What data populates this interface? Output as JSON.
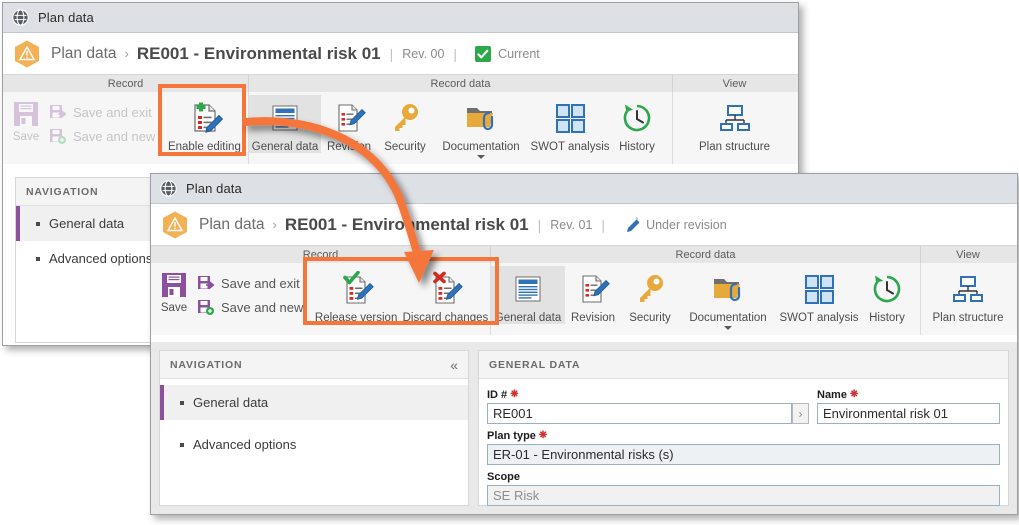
{
  "accent": {
    "highlight_orange": "#f4763b",
    "purple": "#8e4f9e",
    "blue": "#2f72b8",
    "green": "#2aa84a",
    "amber": "#f0ad49",
    "red": "#d42c22"
  },
  "window_back": {
    "titlebar": {
      "icon": "globe-icon",
      "title": "Plan data"
    },
    "header": {
      "app_icon": "warning-hexagon-icon",
      "breadcrumb_app": "Plan data",
      "breadcrumb_separator": "›",
      "record_title": "RE001 - Environmental risk 01",
      "pipe": "|",
      "revision": "Rev. 00",
      "status_icon": "green-check-icon",
      "status": "Current"
    },
    "ribbon": {
      "groups": [
        {
          "label": "Record"
        },
        {
          "label": "Record data"
        },
        {
          "label": "View"
        }
      ],
      "record": {
        "save_label": "Save",
        "save_and_exit_label": "Save and exit",
        "save_and_new_label": "Save and new",
        "enable_editing_label": "Enable editing"
      },
      "record_data": [
        {
          "label": "General data",
          "icon": "document-lines-icon",
          "selected": true
        },
        {
          "label": "Revision",
          "icon": "document-pencil-icon",
          "selected": false
        },
        {
          "label": "Security",
          "icon": "key-icon",
          "selected": false
        },
        {
          "label": "Documentation",
          "icon": "folder-clip-icon",
          "selected": false,
          "has_menu": true
        },
        {
          "label": "SWOT analysis",
          "icon": "four-squares-icon",
          "selected": false
        },
        {
          "label": "History",
          "icon": "clock-revert-icon",
          "selected": false
        }
      ],
      "view": [
        {
          "label": "Plan structure",
          "icon": "org-chart-icon"
        }
      ]
    },
    "navigation": {
      "title": "NAVIGATION",
      "items": [
        {
          "label": "General data",
          "active": true
        },
        {
          "label": "Advanced options",
          "active": false
        }
      ]
    }
  },
  "window_front": {
    "titlebar": {
      "icon": "globe-icon",
      "title": "Plan data"
    },
    "header": {
      "app_icon": "warning-hexagon-icon",
      "breadcrumb_app": "Plan data",
      "breadcrumb_separator": "›",
      "record_title": "RE001 - Environmental risk 01",
      "pipe": "|",
      "revision": "Rev. 01",
      "status_icon": "blue-pencil-icon",
      "status": "Under revision"
    },
    "ribbon": {
      "groups": [
        {
          "label": "Record"
        },
        {
          "label": "Record data"
        },
        {
          "label": "View"
        }
      ],
      "record": {
        "save_label": "Save",
        "save_and_exit_label": "Save and exit",
        "save_and_new_label": "Save and new",
        "release_version_label": "Release version",
        "discard_changes_label": "Discard changes"
      },
      "record_data": [
        {
          "label": "General data",
          "icon": "document-lines-icon",
          "selected": true
        },
        {
          "label": "Revision",
          "icon": "document-pencil-icon",
          "selected": false
        },
        {
          "label": "Security",
          "icon": "key-icon",
          "selected": false
        },
        {
          "label": "Documentation",
          "icon": "folder-clip-icon",
          "selected": false,
          "has_menu": true
        },
        {
          "label": "SWOT analysis",
          "icon": "four-squares-icon",
          "selected": false
        },
        {
          "label": "History",
          "icon": "clock-revert-icon",
          "selected": false
        }
      ],
      "view": [
        {
          "label": "Plan structure",
          "icon": "org-chart-icon"
        }
      ]
    },
    "navigation": {
      "title": "NAVIGATION",
      "collapse_icon": "«",
      "items": [
        {
          "label": "General data",
          "active": true
        },
        {
          "label": "Advanced options",
          "active": false
        }
      ]
    },
    "general_data": {
      "title": "GENERAL DATA",
      "fields": {
        "id_label": "ID #",
        "id_value": "RE001",
        "id_goto_icon": "›",
        "name_label": "Name",
        "name_value": "Environmental risk 01",
        "plan_type_label": "Plan type",
        "plan_type_value": "ER-01 - Environmental risks (s)",
        "scope_label": "Scope",
        "scope_value": "SE Risk"
      }
    }
  },
  "annotations": {
    "highlight_enable_editing": "Enable editing",
    "highlight_release_discard": "Release version / Discard changes",
    "arrow": "curved-orange-arrow"
  }
}
